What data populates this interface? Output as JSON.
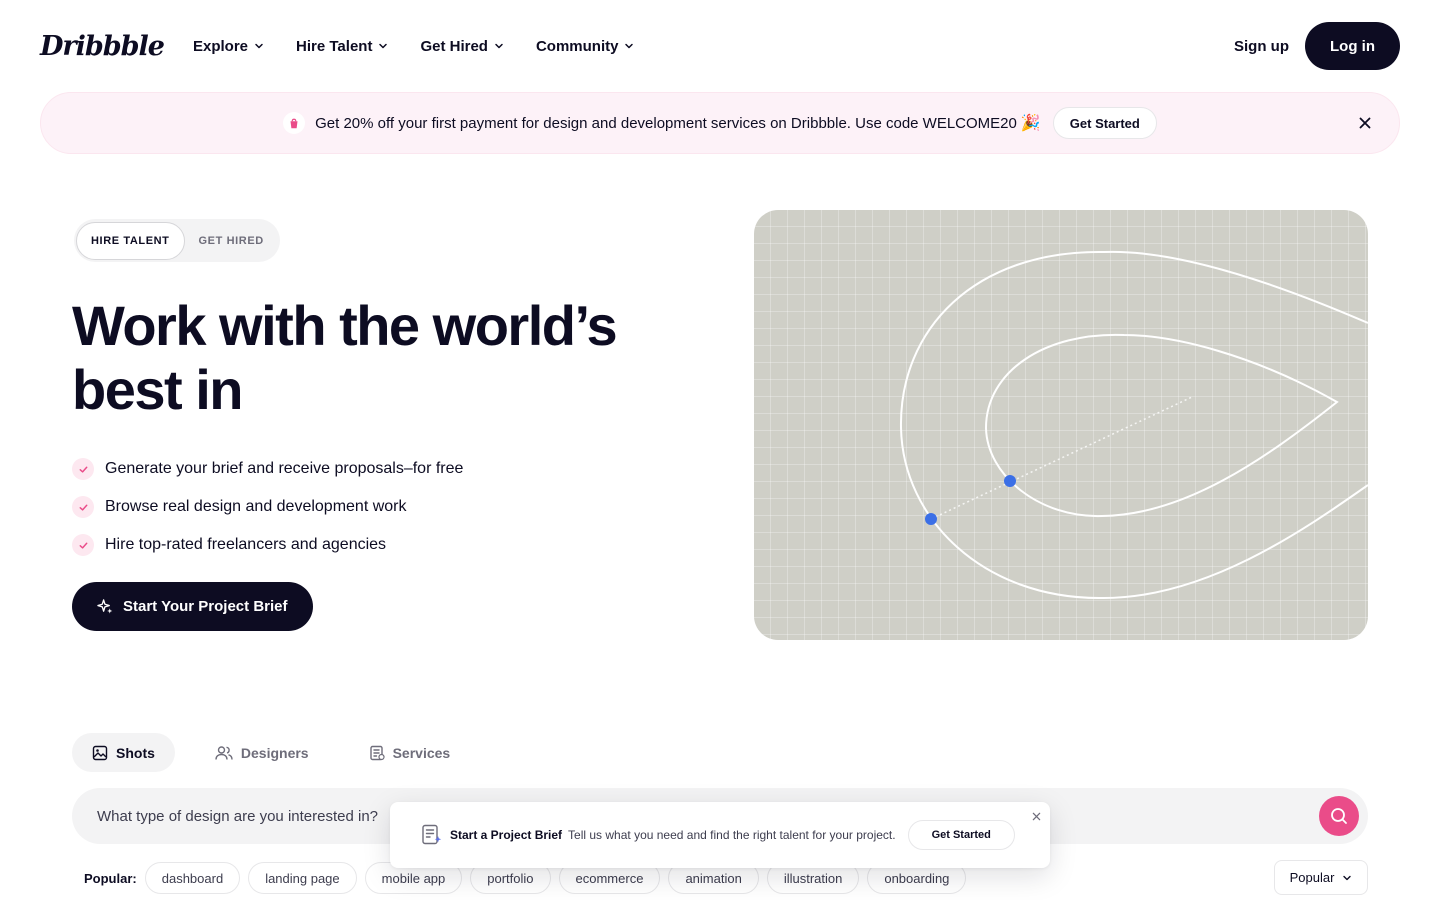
{
  "header": {
    "logo": "Dribbble",
    "nav": [
      {
        "label": "Explore"
      },
      {
        "label": "Hire Talent"
      },
      {
        "label": "Get Hired"
      },
      {
        "label": "Community"
      }
    ],
    "signup_label": "Sign up",
    "login_label": "Log in"
  },
  "promo": {
    "text": "Get 20% off your first payment for design and development services on Dribbble. Use code WELCOME20",
    "emoji": "🎉",
    "button_label": "Get Started"
  },
  "hero": {
    "toggle": [
      "HIRE TALENT",
      "GET HIRED"
    ],
    "title": "Work with the world’s best in",
    "features": [
      "Generate your brief and receive proposals–for free",
      "Browse real design and development work",
      "Hire top-rated freelancers and agencies"
    ],
    "cta_label": "Start Your Project Brief"
  },
  "search": {
    "tabs": [
      {
        "label": "Shots",
        "icon": "image-icon"
      },
      {
        "label": "Designers",
        "icon": "users-icon"
      },
      {
        "label": "Services",
        "icon": "document-icon"
      }
    ],
    "placeholder": "What type of design are you interested in?",
    "popular_label": "Popular:",
    "popular": [
      "dashboard",
      "landing page",
      "mobile app",
      "portfolio",
      "ecommerce",
      "animation",
      "illustration",
      "onboarding"
    ],
    "sort_label": "Popular"
  },
  "brief": {
    "title": "Start a Project Brief",
    "text": "Tell us what you need and find the right talent for your project.",
    "button_label": "Get Started"
  },
  "colors": {
    "ink": "#0d0c22",
    "accent_pink": "#ea4c89",
    "promo_bg": "#fdf2f8",
    "canvas_bg": "#cfcfc7",
    "handle_blue": "#3b6fe6"
  }
}
